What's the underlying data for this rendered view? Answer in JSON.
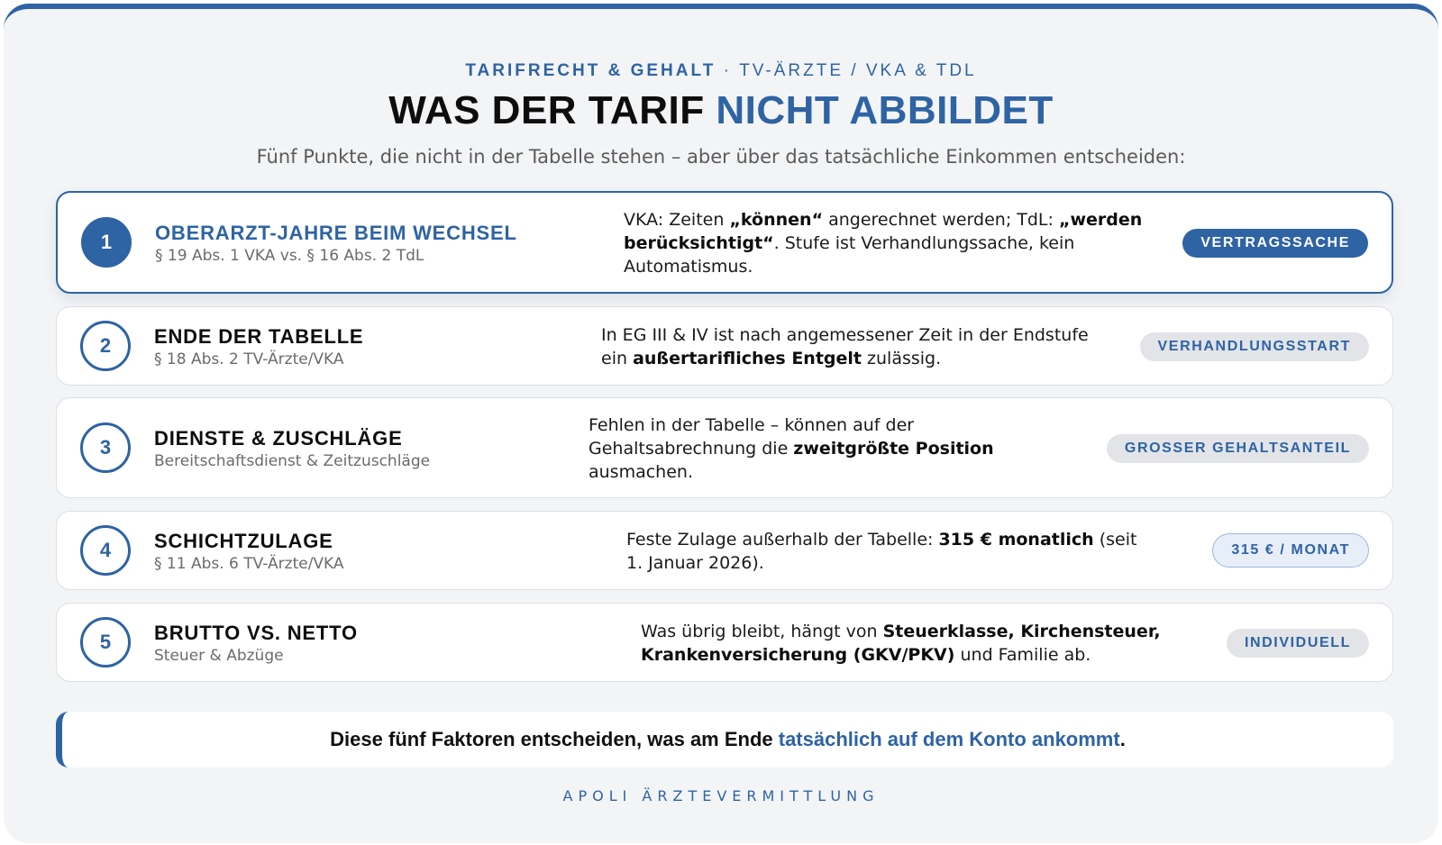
{
  "header": {
    "eyebrow_main": "TARIFRECHT & GEHALT",
    "eyebrow_sep": "·",
    "eyebrow_rest": "TV-ÄRZTE / VKA & TDL",
    "title_dark": "WAS DER TARIF",
    "title_accent": "NICHT ABBILDET",
    "subtitle": "Fünf Punkte, die nicht in der Tabelle stehen – aber über das tatsächliche Einkommen entscheiden:"
  },
  "items": [
    {
      "number": "1",
      "title": "OBERARZT-JAHRE BEIM WECHSEL",
      "subtitle": "§ 19 Abs. 1 VKA vs. § 16 Abs. 2 TdL",
      "desc": [
        {
          "t": "VKA: Zeiten ",
          "b": false
        },
        {
          "t": "„können“",
          "b": true
        },
        {
          "t": " angerechnet werden; TdL: ",
          "b": false
        },
        {
          "t": "„werden berücksichtigt“",
          "b": true
        },
        {
          "t": ". Stufe ist Verhandlungssache, kein Automatismus.",
          "b": false
        }
      ],
      "badge": "VERTRAGSSACHE"
    },
    {
      "number": "2",
      "title": "ENDE DER TABELLE",
      "subtitle": "§ 18 Abs. 2 TV-Ärzte/VKA",
      "desc": [
        {
          "t": "In EG III & IV ist nach angemessener Zeit in der Endstufe ein ",
          "b": false
        },
        {
          "t": "außertarifliches Entgelt",
          "b": true
        },
        {
          "t": " zulässig.",
          "b": false
        }
      ],
      "badge": "VERHANDLUNGSSTART"
    },
    {
      "number": "3",
      "title": "DIENSTE & ZUSCHLÄGE",
      "subtitle": "Bereitschaftsdienst & Zeitzuschläge",
      "desc": [
        {
          "t": "Fehlen in der Tabelle – können auf der Gehaltsabrechnung die ",
          "b": false
        },
        {
          "t": "zweitgrößte Position",
          "b": true
        },
        {
          "t": " ausmachen.",
          "b": false
        }
      ],
      "badge": "GROSSER GEHALTSANTEIL"
    },
    {
      "number": "4",
      "title": "SCHICHTZULAGE",
      "subtitle": "§ 11 Abs. 6 TV-Ärzte/VKA",
      "desc": [
        {
          "t": "Feste Zulage außerhalb der Tabelle: ",
          "b": false
        },
        {
          "t": "315 € monatlich",
          "b": true
        },
        {
          "t": " (seit 1. Januar 2026).",
          "b": false
        }
      ],
      "badge": "315 € / MONAT"
    },
    {
      "number": "5",
      "title": "BRUTTO VS. NETTO",
      "subtitle": "Steuer & Abzüge",
      "desc": [
        {
          "t": "Was übrig bleibt, hängt von ",
          "b": false
        },
        {
          "t": "Steuerklasse, Kirchensteuer, Krankenversicherung (GKV/PKV)",
          "b": true
        },
        {
          "t": " und Familie ab.",
          "b": false
        }
      ],
      "badge": "INDIVIDUELL"
    }
  ],
  "banner": {
    "before": "Diese fünf Faktoren entscheiden, was am Ende ",
    "highlight": "tatsächlich auf dem Konto ankommt",
    "after": "."
  },
  "footer": "APOLI ÄRZTEVERMITTLUNG",
  "colors": {
    "accent": "#2e63a4",
    "background": "#f3f4f6",
    "badge_grey": "#e2e4e8"
  }
}
